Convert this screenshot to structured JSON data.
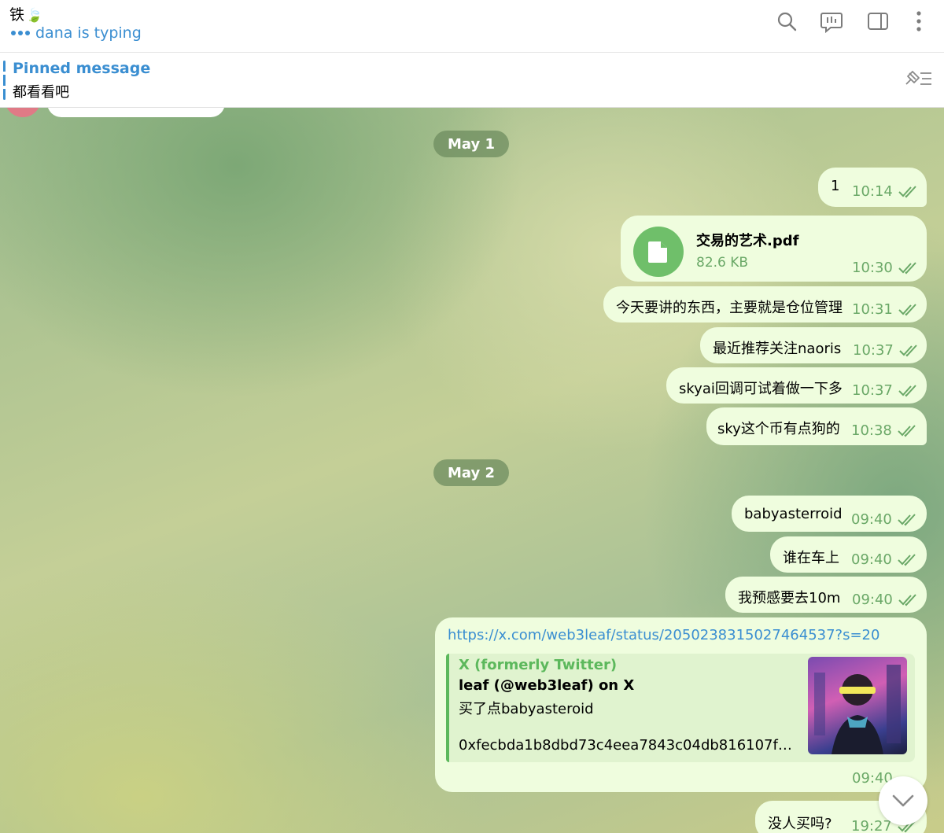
{
  "header": {
    "title": "铁",
    "title_emoji": "🍃",
    "status": "dana is typing",
    "icons": [
      "search-icon",
      "poll-icon",
      "sidebar-toggle-icon",
      "more-vertical-icon"
    ]
  },
  "pinned": {
    "title": "Pinned message",
    "text": "都看看吧",
    "icon": "pin-list-icon"
  },
  "dates": [
    "May 1",
    "May 2"
  ],
  "messages": [
    {
      "text": "1",
      "time": "10:14"
    },
    {
      "file_name": "交易的艺术.pdf",
      "file_size": "82.6 KB",
      "time": "10:30"
    },
    {
      "text": "今天要讲的东西，主要就是仓位管理",
      "time": "10:31"
    },
    {
      "text": "最近推荐关注naoris",
      "time": "10:37"
    },
    {
      "text": "skyai回调可试着做一下多",
      "time": "10:37"
    },
    {
      "text": "sky这个币有点狗的",
      "time": "10:38"
    },
    {
      "text": "babyasterroid",
      "time": "09:40"
    },
    {
      "text": "谁在车上",
      "time": "09:40"
    },
    {
      "text": "我预感要去10m",
      "time": "09:40"
    },
    {
      "link": "https://x.com/web3leaf/status/2050238315027464537?s=20",
      "preview": {
        "site": "X (formerly Twitter)",
        "title": "leaf (@web3leaf) on X",
        "desc": "买了点babyasteroid",
        "address": "0xfecbda1b8dbd73c4eea7843c04db816107fa66..."
      },
      "time": "09:40"
    },
    {
      "text": "没人买吗?",
      "time": "19:27"
    }
  ],
  "colors": {
    "accent": "#3a8ed1",
    "bubble_out": "#effdde",
    "time_green": "#6aa867",
    "date_pill": "#6e8c5f"
  }
}
